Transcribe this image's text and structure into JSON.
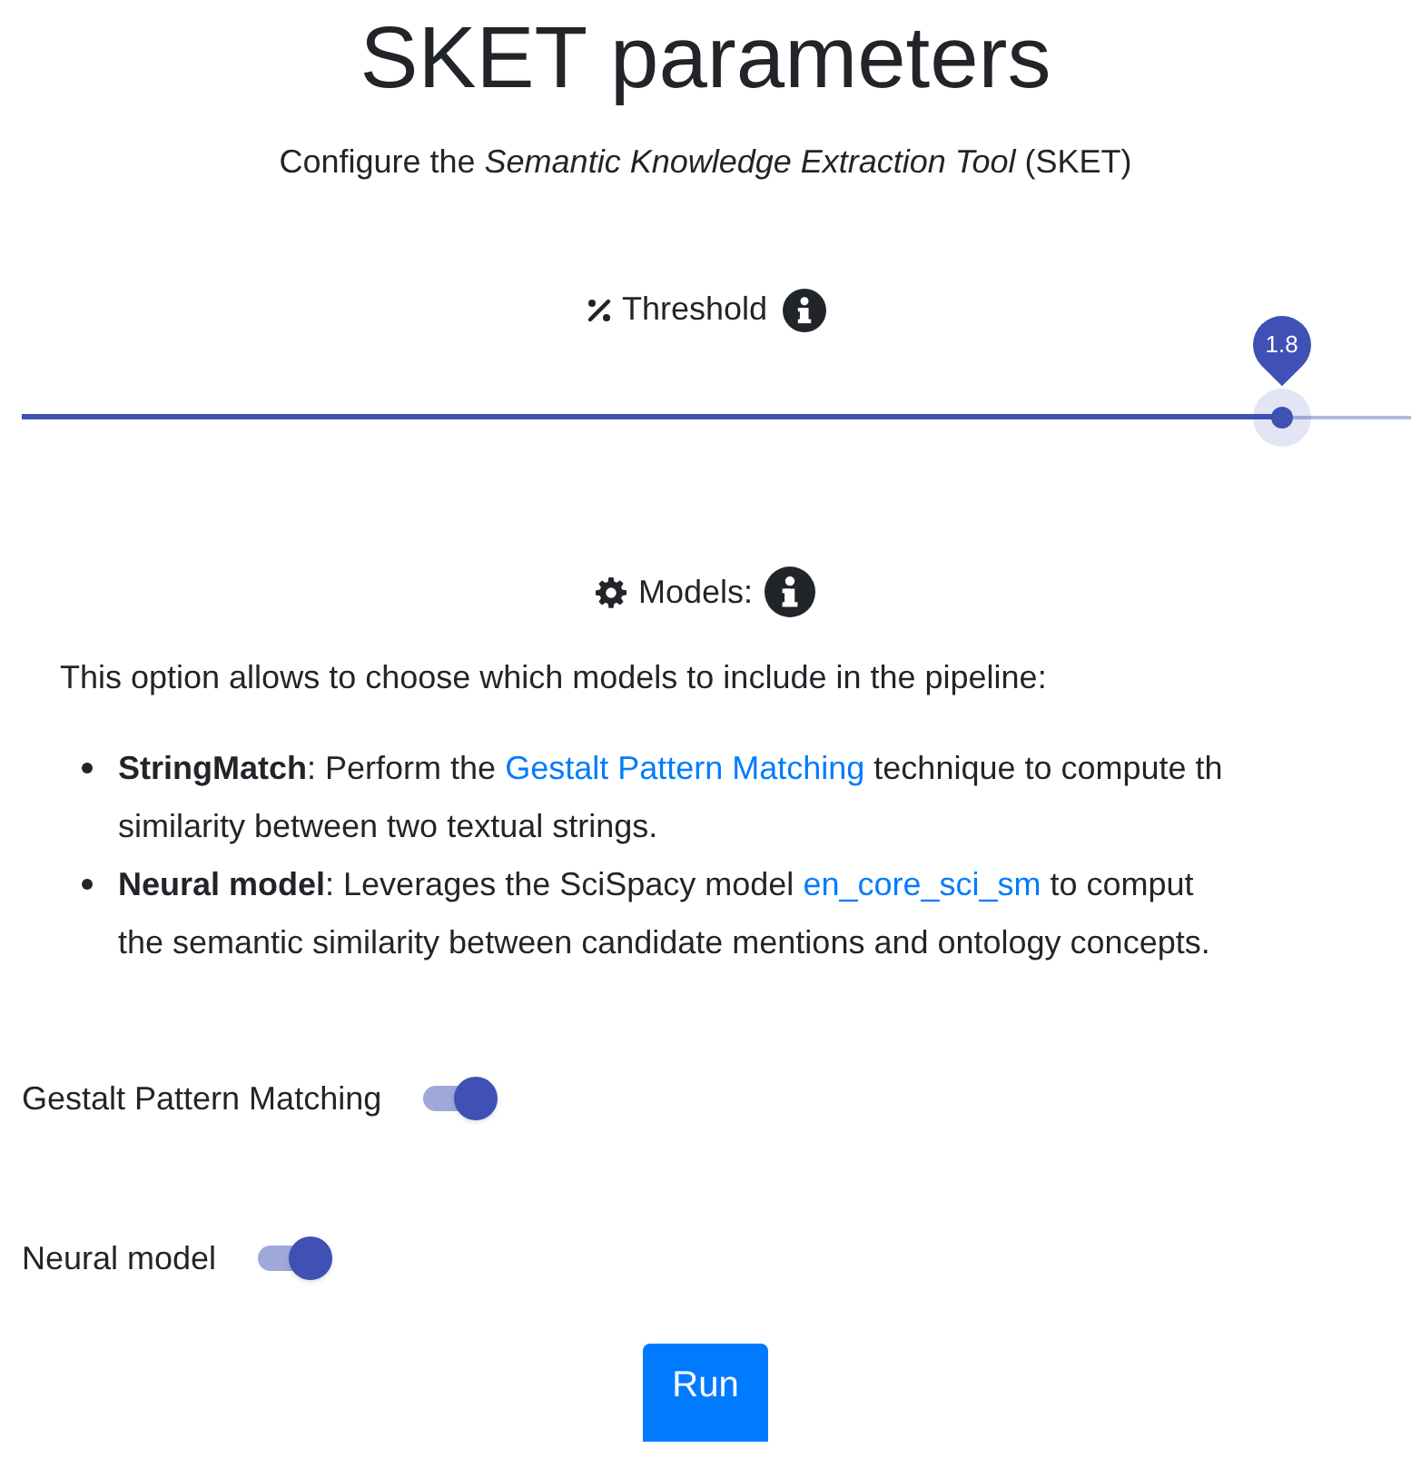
{
  "title": "SKET parameters",
  "subtitle": "Configure the *Semantic Knowledge Extraction Tool* (SKET)",
  "threshold": {
    "label": "Threshold",
    "value_label": "1.8",
    "level": 0.907
  },
  "models": {
    "label": "Models:",
    "intro": "This option allows to choose which models to include in the pipeline:",
    "bullets": [
      {
        "term": "StringMatch",
        "line1_before": ": Perform the ",
        "link": "Gestalt Pattern Matching",
        "line1_after": " technique to compute th",
        "line2": "similarity between two textual strings."
      },
      {
        "term": "Neural model",
        "line1_before": ": Leverages the SciSpacy model ",
        "link": "en_core_sci_sm",
        "line1_after": " to comput",
        "line2": "the semantic similarity between candidate mentions and ontology concepts."
      }
    ]
  },
  "toggles": [
    {
      "label": "Gestalt Pattern Matching",
      "on": true
    },
    {
      "label": "Neural model",
      "on": true
    }
  ],
  "run_button": "Run"
}
